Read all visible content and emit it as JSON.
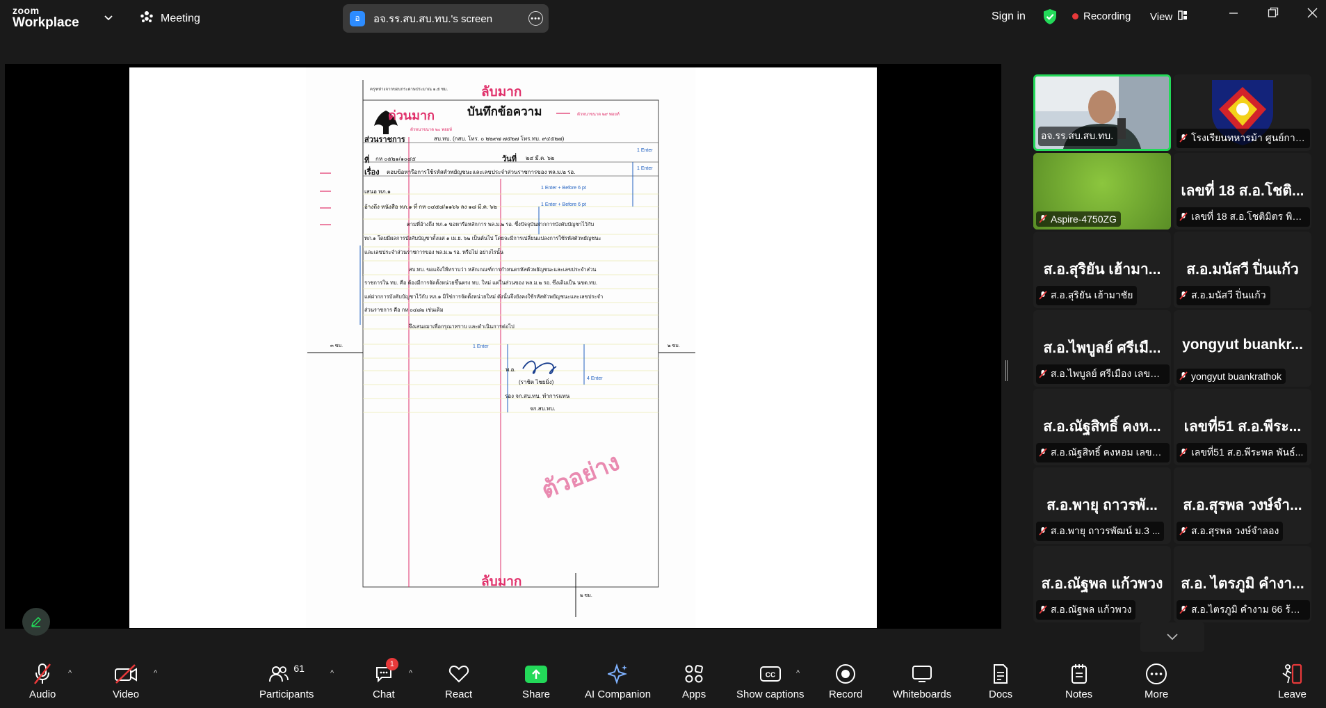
{
  "app": {
    "brand_line1": "zoom",
    "brand_line2": "Workplace"
  },
  "header": {
    "meeting_label": "Meeting",
    "screen_share_badge": "อ",
    "screen_share_title": "อจ.รร.สบ.สบ.ทบ.'s screen",
    "sign_in": "Sign in",
    "recording": "Recording",
    "view": "View"
  },
  "document": {
    "top_note": "ครุฑห่างจากขอบกระดาษประมาณ ๑.๕ ซม.",
    "secret_top": "ลับมาก",
    "urgent": "ด่วนมาก",
    "title": "บันทึกข้อความ",
    "font_note_29": "ตัวหนาขนาด ๒๙ พอยท์",
    "font_note_20": "ตัวหนาขนาด ๒๐ พอยท์",
    "agency_label": "ส่วนราชการ",
    "agency_value": "สบ.ทบ.  (กสบ. โทร. ๐ ๒๒๙๗ ๗๕๒๗ โทร.ทบ. ๙๔๕๒๗)",
    "ref_label": "ที่",
    "ref_value": "กห ๐๕๒๑/๑๐๔๕",
    "date_label": "วันที่",
    "date_value": "๒๔ มี.ค. ๖๒",
    "subject_label": "เรื่อง",
    "subject_value": "ตอบข้อหารือการใช้รหัสตัวพยัญชนะและเลขประจำส่วนราชการของ พล.ม.๒ รอ.",
    "to_line": "เสนอ ทภ.๑",
    "ref_line": "อ้างถึง หนังสือ ทภ.๑ ที่ กห ๐๔๕๘/๑๑๖๖ ลง ๑๘ มี.ค. ๖๒",
    "para1": "ตามที่อ้างถึง ทภ.๑ ขอหารือหลักการ พล.ม.๒ รอ. ซึ่งปัจจุบันฝากการบังคับบัญชาไว้กับ",
    "para1b": "ทภ.๑ โดยมีผลการบังคับบัญชาตั้งแต่ ๑ เม.ย. ๖๒ เป็นต้นไป โดยจะมีการเปลี่ยนแปลงการใช้รหัสตัวพยัญชนะ",
    "para1c": "และเลขประจำส่วนราชการของ พล.ม.๒ รอ. หรือไม่ อย่างไรนั้น",
    "para2": "สบ.ทบ. ขอแจ้งให้ทราบว่า หลักเกณฑ์การกำหนดรหัสตัวพยัญชนะและเลขประจำส่วน",
    "para2b": "ราชการใน ทบ. คือ ต้องมีการจัดตั้งหน่วยขึ้นตรง ทบ. ใหม่ แต่ในส่วนของ พล.ม.๒ รอ. ซึ่งเดิมเป็น นขต.ทบ.",
    "para2c": "แต่ฝากการบังคับบัญชาไว้กับ ทภ.๑ มิใช่การจัดตั้งหน่วยใหม่ ดังนั้นจึงยังคงใช้รหัสตัวพยัญชนะและเลขประจำ",
    "para2d": "ส่วนราชการ คือ กห ๐๔๘๒ เช่นเดิม",
    "para3": "จึงเสนอมาเพื่อกรุณาทราบ และดำเนินการต่อไป",
    "rank": "พ.อ.",
    "sign_name": "(ราชิต  ไชยมิ่ง)",
    "sign_pos1": "รอง จก.สบ.ทบ. ทำการแทน",
    "sign_pos2": "จก.สบ.ทบ.",
    "watermark": "ตัวอย่าง",
    "secret_bottom": "ลับมาก",
    "enter1": "1 Enter",
    "enter_before6": "1 Enter + Before 6 pt",
    "enter4": "4 Enter",
    "margin_left": "๓ ซม.",
    "margin_right": "๒ ซม.",
    "margin_bottom": "๒ ซม."
  },
  "gallery": [
    {
      "big": "",
      "tag": "อจ.รร.สบ.สบ.ทบ.",
      "muted": false,
      "kind": "video"
    },
    {
      "big": "",
      "tag": "โรงเรียนทหารม้า ศูนย์การ...",
      "muted": true,
      "kind": "logo"
    },
    {
      "big": "",
      "tag": "Aspire-4750ZG",
      "muted": true,
      "kind": "green"
    },
    {
      "big": "เลขที่ 18 ส.อ.โชติ...",
      "tag": "เลขที่ 18 ส.อ.โชติมิตร พิชิ...",
      "muted": true,
      "kind": "name"
    },
    {
      "big": "ส.อ.สุริยัน  เฮ้ามา...",
      "tag": "ส.อ.สุริยัน  เฮ้ามาชัย",
      "muted": true,
      "kind": "name"
    },
    {
      "big": "ส.อ.มนัสวี ปิ่นแก้ว",
      "tag": "ส.อ.มนัสวี ปิ่นแก้ว",
      "muted": true,
      "kind": "name"
    },
    {
      "big": "ส.อ.ไพบูลย์ ศรีเมื...",
      "tag": "ส.อ.ไพบูลย์ ศรีเมือง เลขที่16",
      "muted": true,
      "kind": "name"
    },
    {
      "big": "yongyut buankr...",
      "tag": "yongyut buankrathok",
      "muted": true,
      "kind": "name"
    },
    {
      "big": "ส.อ.ณัฐสิทธิ์ คงห...",
      "tag": "ส.อ.ณัฐสิทธิ์ คงหอม เลขที่ 7",
      "muted": true,
      "kind": "name"
    },
    {
      "big": "เลขที่51 ส.อ.พีระ...",
      "tag": "เลขที่51 ส.อ.พีระพล พันธ์...",
      "muted": true,
      "kind": "name"
    },
    {
      "big": "ส.อ.พายุ  ถาวรพั...",
      "tag": "ส.อ.พายุ  ถาวรพัฒน์ ม.3 ...",
      "muted": true,
      "kind": "name"
    },
    {
      "big": "ส.อ.สุรพล วงษ์จำ...",
      "tag": "ส.อ.สุรพล วงษ์จำลอง",
      "muted": true,
      "kind": "name"
    },
    {
      "big": "ส.อ.ณัฐพล แก้วพวง",
      "tag": "ส.อ.ณัฐพล แก้วพวง",
      "muted": true,
      "kind": "name"
    },
    {
      "big": "ส.อ. ไตรภูมิ คำงา...",
      "tag": "ส.อ.ไตรภูมิ คำงาม 66 ร้อย...",
      "muted": true,
      "kind": "name"
    }
  ],
  "toolbar": {
    "audio": "Audio",
    "video": "Video",
    "participants": "Participants",
    "participants_count": "61",
    "chat": "Chat",
    "chat_badge": "1",
    "react": "React",
    "share": "Share",
    "ai_companion": "AI Companion",
    "apps": "Apps",
    "captions": "Show captions",
    "record": "Record",
    "whiteboards": "Whiteboards",
    "docs": "Docs",
    "notes": "Notes",
    "more": "More",
    "leave": "Leave"
  },
  "colors": {
    "accent_green": "#23d959",
    "record_red": "#e8393a",
    "brand_blue": "#2d8cff",
    "doc_red": "#e0306a"
  }
}
